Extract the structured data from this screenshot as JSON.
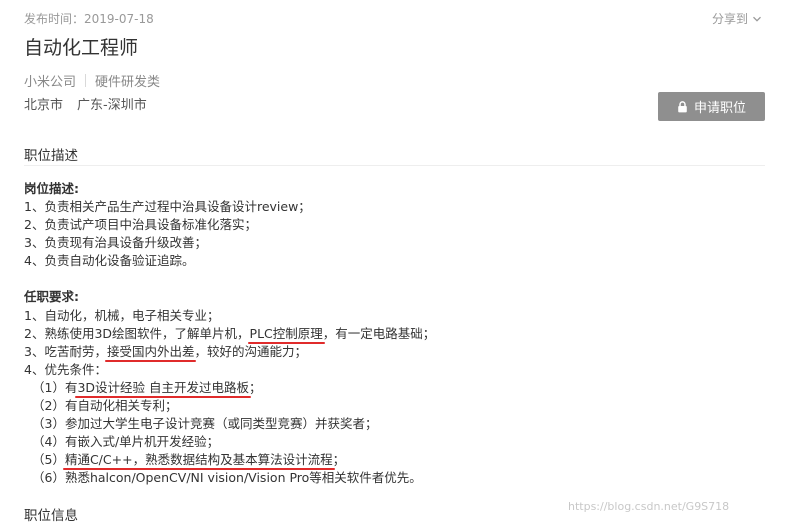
{
  "header": {
    "publish_time": "发布时间：2019-07-18",
    "share_label": "分享到",
    "title": "自动化工程师",
    "company": "小米公司",
    "category": "硬件研发类",
    "locations": [
      "北京市",
      "广东-深圳市"
    ],
    "apply_label": "申请职位"
  },
  "sections": {
    "description_title": "职位描述",
    "info_title": "职位信息"
  },
  "description": {
    "duties_title": "岗位描述:",
    "duties": [
      "1、负责相关产品生产过程中治具设备设计review；",
      "2、负责试产项目中治具设备标准化落实；",
      "3、负责现有治具设备升级改善；",
      "4、负责自动化设备验证追踪。"
    ],
    "req_title": "任职要求:",
    "req1": "1、自动化，机械，电子相关专业；",
    "req2": {
      "a": "2、熟练使用3D绘图软件，了解单片机，",
      "hl": "PLC控制原理",
      "b": "，有一定电路基础；"
    },
    "req3": {
      "a": "3、吃苦耐劳，",
      "hl": "接受国内外出差",
      "b": "，较好的沟通能力；"
    },
    "req4": "4、优先条件：",
    "pref1": {
      "a": "（1）有",
      "hl": "3D设计经验 自主开发过电路板",
      "b": "；"
    },
    "pref2": "（2）有自动化相关专利；",
    "pref3": "（3）参加过大学生电子设计竞赛（或同类型竞赛）并获奖者；",
    "pref4": "（4）有嵌入式/单片机开发经验；",
    "pref5": {
      "a": "（5）",
      "hl": "精通C/C++，熟悉数据结构及基本算法设计流程",
      "b": "；"
    },
    "pref6": "（6）熟悉halcon/OpenCV/NI vision/Vision Pro等相关软件者优先。"
  },
  "watermark": "https://blog.csdn.net/G9S718",
  "colors": {
    "apply_button_bg": "#8f8f8f",
    "underline": "#e02b2b",
    "meta_text": "#888888"
  },
  "icons": {
    "share": "chevron-down-icon",
    "apply": "lock-icon"
  }
}
